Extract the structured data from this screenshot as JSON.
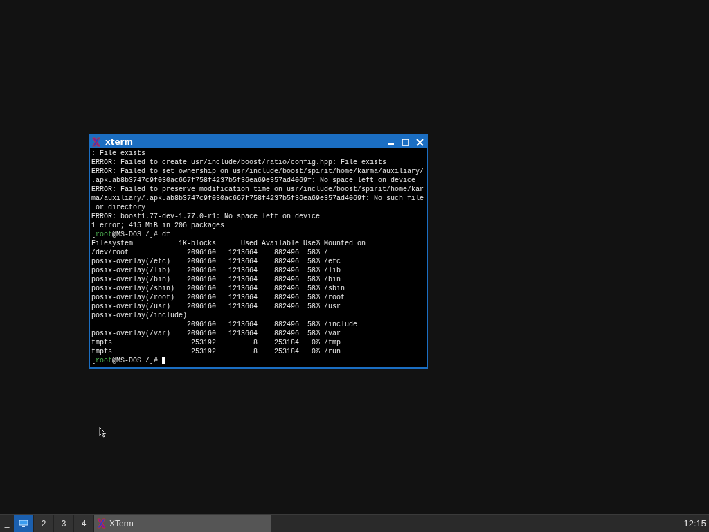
{
  "window": {
    "title": "xterm",
    "focused": true
  },
  "terminal": {
    "lines": [
      {
        "kind": "output",
        "text": ": File exists"
      },
      {
        "kind": "output",
        "text": "ERROR: Failed to create usr/include/boost/ratio/config.hpp: File exists"
      },
      {
        "kind": "output",
        "text": "ERROR: Failed to set ownership on usr/include/boost/spirit/home/karma/auxiliary/"
      },
      {
        "kind": "output",
        "text": ".apk.ab8b3747c9f030ac667f758f4237b5f36ea69e357ad4069f: No space left on device"
      },
      {
        "kind": "output",
        "text": "ERROR: Failed to preserve modification time on usr/include/boost/spirit/home/kar"
      },
      {
        "kind": "output",
        "text": "ma/auxiliary/.apk.ab8b3747c9f030ac667f758f4237b5f36ea69e357ad4069f: No such file"
      },
      {
        "kind": "output",
        "text": " or directory"
      },
      {
        "kind": "output",
        "text": "ERROR: boost1.77-dev-1.77.0-r1: No space left on device"
      },
      {
        "kind": "output",
        "text": "1 error; 415 MiB in 206 packages"
      },
      {
        "kind": "prompt",
        "open": "[",
        "user": "root",
        "host": "@MS-DOS /",
        "close": "]# ",
        "command": "df",
        "cursor": false
      },
      {
        "kind": "output",
        "text": "Filesystem           1K-blocks      Used Available Use% Mounted on"
      },
      {
        "kind": "output",
        "text": "/dev/root              2096160   1213664    882496  58% /"
      },
      {
        "kind": "output",
        "text": "posix-overlay(/etc)    2096160   1213664    882496  58% /etc"
      },
      {
        "kind": "output",
        "text": "posix-overlay(/lib)    2096160   1213664    882496  58% /lib"
      },
      {
        "kind": "output",
        "text": "posix-overlay(/bin)    2096160   1213664    882496  58% /bin"
      },
      {
        "kind": "output",
        "text": "posix-overlay(/sbin)   2096160   1213664    882496  58% /sbin"
      },
      {
        "kind": "output",
        "text": "posix-overlay(/root)   2096160   1213664    882496  58% /root"
      },
      {
        "kind": "output",
        "text": "posix-overlay(/usr)    2096160   1213664    882496  58% /usr"
      },
      {
        "kind": "output",
        "text": "posix-overlay(/include)"
      },
      {
        "kind": "output",
        "text": "                       2096160   1213664    882496  58% /include"
      },
      {
        "kind": "output",
        "text": "posix-overlay(/var)    2096160   1213664    882496  58% /var"
      },
      {
        "kind": "output",
        "text": "tmpfs                   253192         8    253184   0% /tmp"
      },
      {
        "kind": "output",
        "text": "tmpfs                   253192         8    253184   0% /run"
      },
      {
        "kind": "prompt",
        "open": "[",
        "user": "root",
        "host": "@MS-DOS /",
        "close": "]# ",
        "cursor": true
      }
    ]
  },
  "taskbar": {
    "menu_label": "_",
    "workspaces": [
      {
        "kind": "icon",
        "selected": true
      },
      {
        "kind": "number",
        "label": "2",
        "selected": false
      },
      {
        "kind": "number",
        "label": "3",
        "selected": false
      },
      {
        "kind": "number",
        "label": "4",
        "selected": false
      }
    ],
    "tasks": [
      {
        "label": "XTerm",
        "selected": true
      }
    ],
    "clock": "12:15"
  }
}
